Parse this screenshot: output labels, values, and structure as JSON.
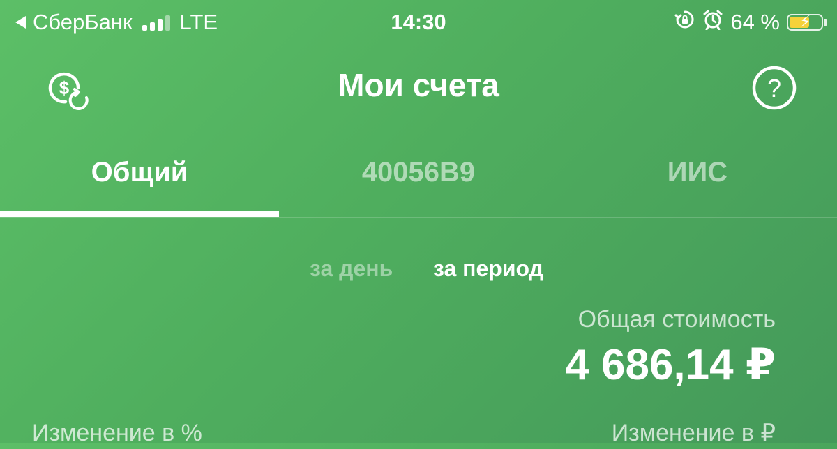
{
  "status_bar": {
    "back_app": "СберБанк",
    "network": "LTE",
    "time": "14:30",
    "battery_percent": "64 %",
    "battery_level": 0.64,
    "battery_color": "#f5d23a",
    "icons": [
      "back-arrow-icon",
      "signal-icon",
      "orientation-lock-icon",
      "alarm-icon",
      "battery-charging-icon"
    ]
  },
  "header": {
    "title": "Мои счета",
    "left_icon": "currency-exchange-icon",
    "right_icon": "help-icon"
  },
  "tabs": [
    {
      "label": "Общий",
      "active": true
    },
    {
      "label": "40056B9",
      "active": false
    },
    {
      "label": "ИИС",
      "active": false
    }
  ],
  "period": {
    "day_label": "за день",
    "period_label": "за период",
    "selected": "за период"
  },
  "summary": {
    "total_label": "Общая стоимость",
    "total_value": "4 686,14 ₽",
    "change_percent_label": "Изменение в %",
    "change_rub_label": "Изменение в ₽"
  },
  "colors": {
    "background_start": "#5cbf67",
    "background_end": "#44995a",
    "text": "#ffffff"
  }
}
